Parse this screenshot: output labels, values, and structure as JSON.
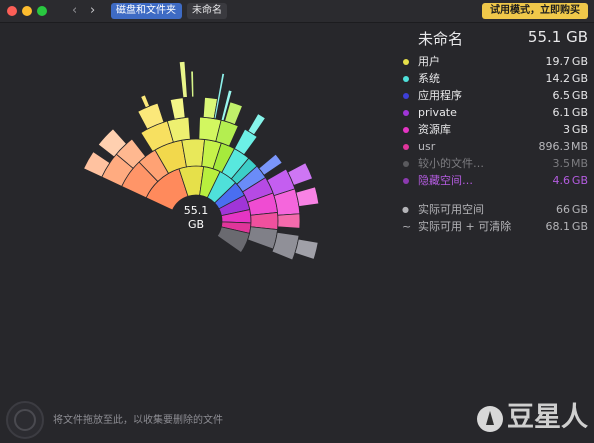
{
  "titlebar": {
    "back_glyph": "‹",
    "forward_glyph": "›",
    "breadcrumb": [
      "磁盘和文件夹",
      "未命名"
    ],
    "trial_button": "试用模式，立即购买"
  },
  "center": {
    "size": "55.1",
    "unit": "GB"
  },
  "panel": {
    "header": {
      "name": "未命名",
      "size": "55.1 GB"
    },
    "items": [
      {
        "name": "用户",
        "size": "19.7",
        "unit": "GB",
        "color": "#e6e04a"
      },
      {
        "name": "系统",
        "size": "14.2",
        "unit": "GB",
        "color": "#4fe0da"
      },
      {
        "name": "应用程序",
        "size": "6.5",
        "unit": "GB",
        "color": "#3d3fd8"
      },
      {
        "name": "private",
        "size": "6.1",
        "unit": "GB",
        "color": "#a035d8"
      },
      {
        "name": "资源库",
        "size": "3",
        "unit": "GB",
        "color": "#e535c4"
      },
      {
        "name": "usr",
        "size": "896.3",
        "unit": "MB",
        "color": "#e0359a"
      },
      {
        "name": "较小的文件…",
        "size": "3.5",
        "unit": "MB",
        "color": "#5a5a5e"
      },
      {
        "name": "隐藏空间…",
        "size": "4.6",
        "unit": "GB",
        "color": "#8c3ab0",
        "highlight": "#b45ce0"
      }
    ],
    "free": [
      {
        "glyph": "●",
        "name": "实际可用空间",
        "size": "66",
        "unit": "GB"
      },
      {
        "glyph": "~",
        "name": "实际可用 + 可清除",
        "size": "68.1",
        "unit": "GB"
      }
    ]
  },
  "footer": {
    "hint": "将文件拖放至此，以收集要删除的文件",
    "watermark": "豆星人"
  }
}
